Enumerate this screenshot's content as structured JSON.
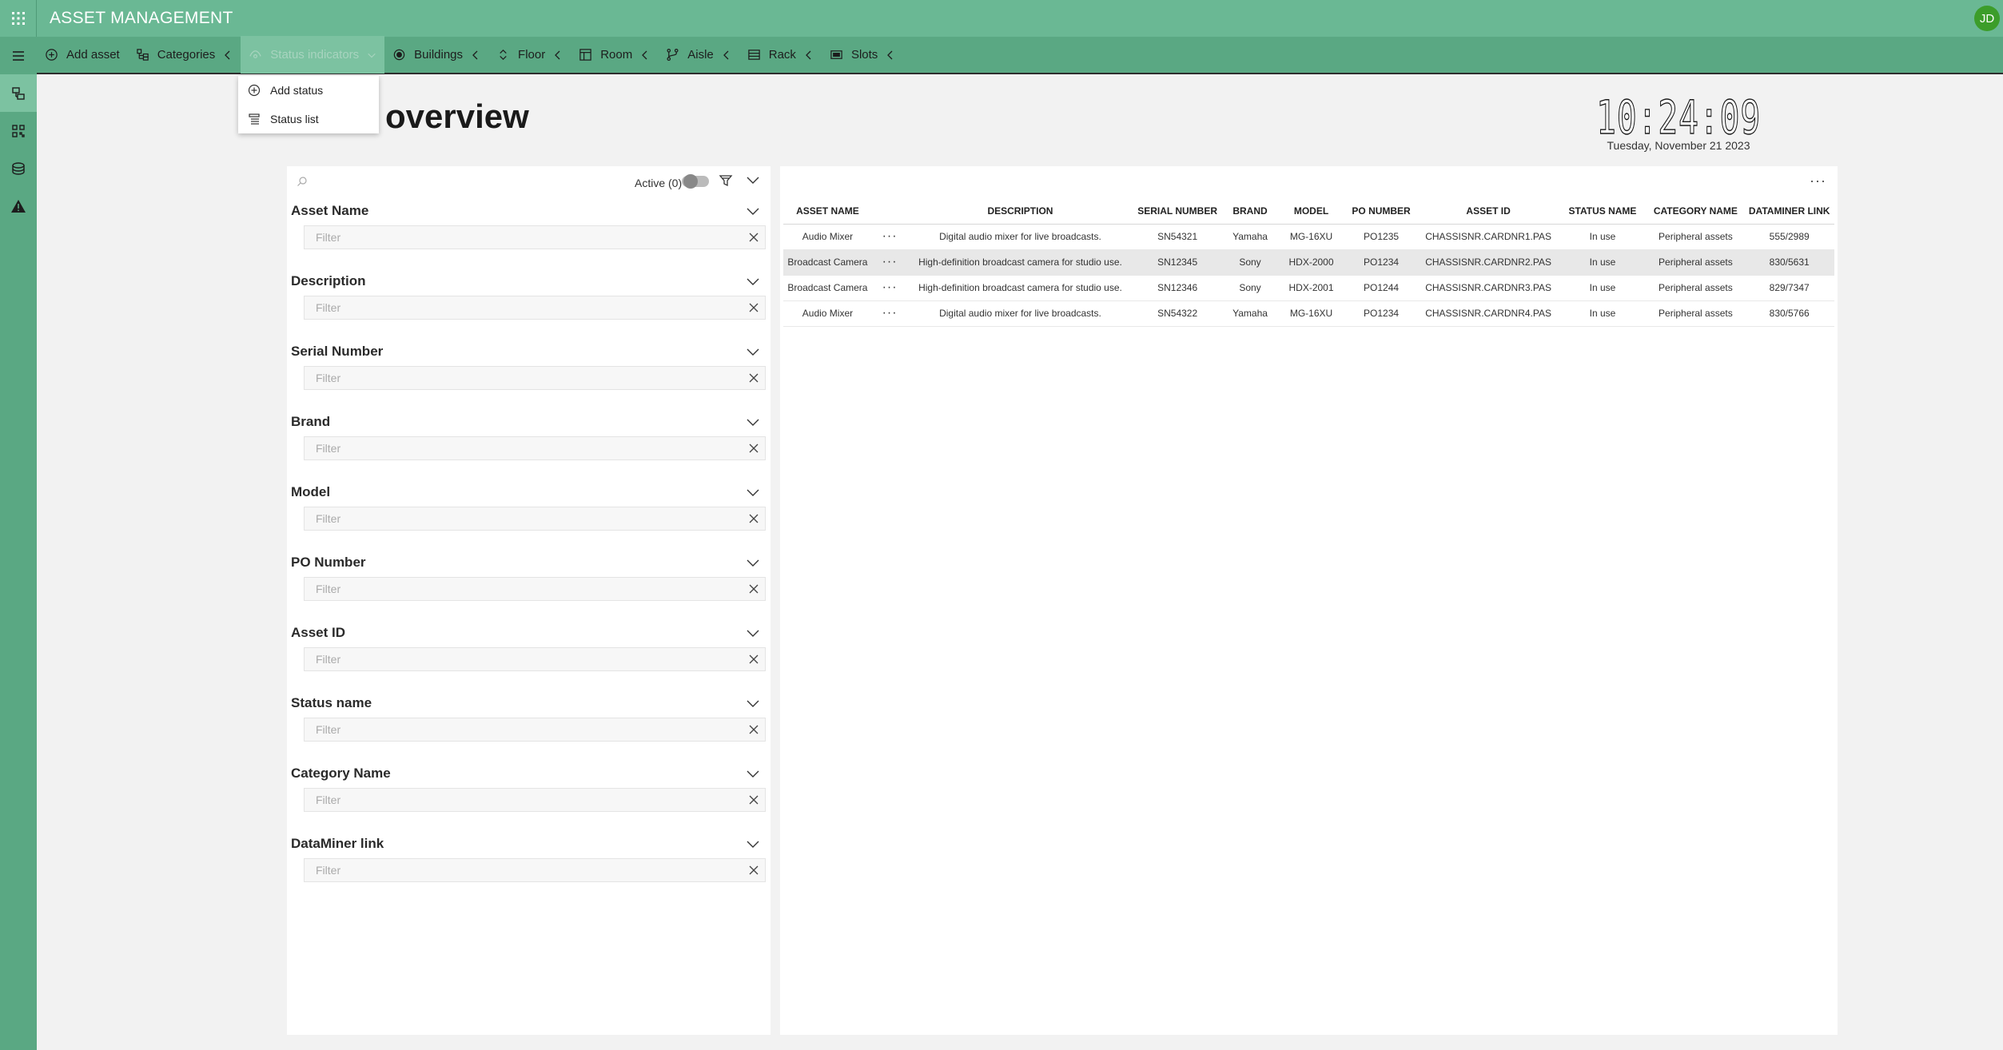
{
  "app": {
    "title": "ASSET MANAGEMENT",
    "user_initials": "JD"
  },
  "toolbar": {
    "items": [
      {
        "label": "Add asset",
        "icon": "plus-circle-icon"
      },
      {
        "label": "Categories",
        "icon": "categories-icon"
      },
      {
        "label": "Status indicators",
        "icon": "status-icon"
      },
      {
        "label": "Buildings",
        "icon": "target-icon"
      },
      {
        "label": "Floor",
        "icon": "up-down-icon"
      },
      {
        "label": "Room",
        "icon": "room-icon"
      },
      {
        "label": "Aisle",
        "icon": "branch-icon"
      },
      {
        "label": "Rack",
        "icon": "rack-icon"
      },
      {
        "label": "Slots",
        "icon": "slot-icon"
      }
    ]
  },
  "dropdown": {
    "items": [
      {
        "label": "Add status",
        "icon": "plus-circle-icon"
      },
      {
        "label": "Status list",
        "icon": "list-icon"
      }
    ]
  },
  "page": {
    "title": "overview"
  },
  "clock": {
    "time": "10:24:09",
    "date": "Tuesday, November 21 2023"
  },
  "filters": {
    "active_label": "Active (0)",
    "placeholder": "Filter",
    "sections": [
      "Asset Name",
      "Description",
      "Serial Number",
      "Brand",
      "Model",
      "PO Number",
      "Asset ID",
      "Status name",
      "Category Name",
      "DataMiner link"
    ]
  },
  "table": {
    "columns": [
      "ASSET NAME",
      "",
      "DESCRIPTION",
      "SERIAL NUMBER",
      "BRAND",
      "MODEL",
      "PO NUMBER",
      "ASSET ID",
      "STATUS NAME",
      "CATEGORY NAME",
      "DATAMINER LINK"
    ],
    "rows": [
      [
        "Audio Mixer",
        "···",
        "Digital audio mixer for live broadcasts.",
        "SN54321",
        "Yamaha",
        "MG-16XU",
        "PO1235",
        "CHASSISNR.CARDNR1.PAS",
        "In use",
        "Peripheral assets",
        "555/2989"
      ],
      [
        "Broadcast Camera",
        "···",
        "High-definition broadcast camera for studio use.",
        "SN12345",
        "Sony",
        "HDX-2000",
        "PO1234",
        "CHASSISNR.CARDNR2.PAS",
        "In use",
        "Peripheral assets",
        "830/5631"
      ],
      [
        "Broadcast Camera",
        "···",
        "High-definition broadcast camera for studio use.",
        "SN12346",
        "Sony",
        "HDX-2001",
        "PO1244",
        "CHASSISNR.CARDNR3.PAS",
        "In use",
        "Peripheral assets",
        "829/7347"
      ],
      [
        "Audio Mixer",
        "···",
        "Digital audio mixer for live broadcasts.",
        "SN54322",
        "Yamaha",
        "MG-16XU",
        "PO1234",
        "CHASSISNR.CARDNR4.PAS",
        "In use",
        "Peripheral assets",
        "830/5766"
      ]
    ],
    "selected_row": 1
  }
}
